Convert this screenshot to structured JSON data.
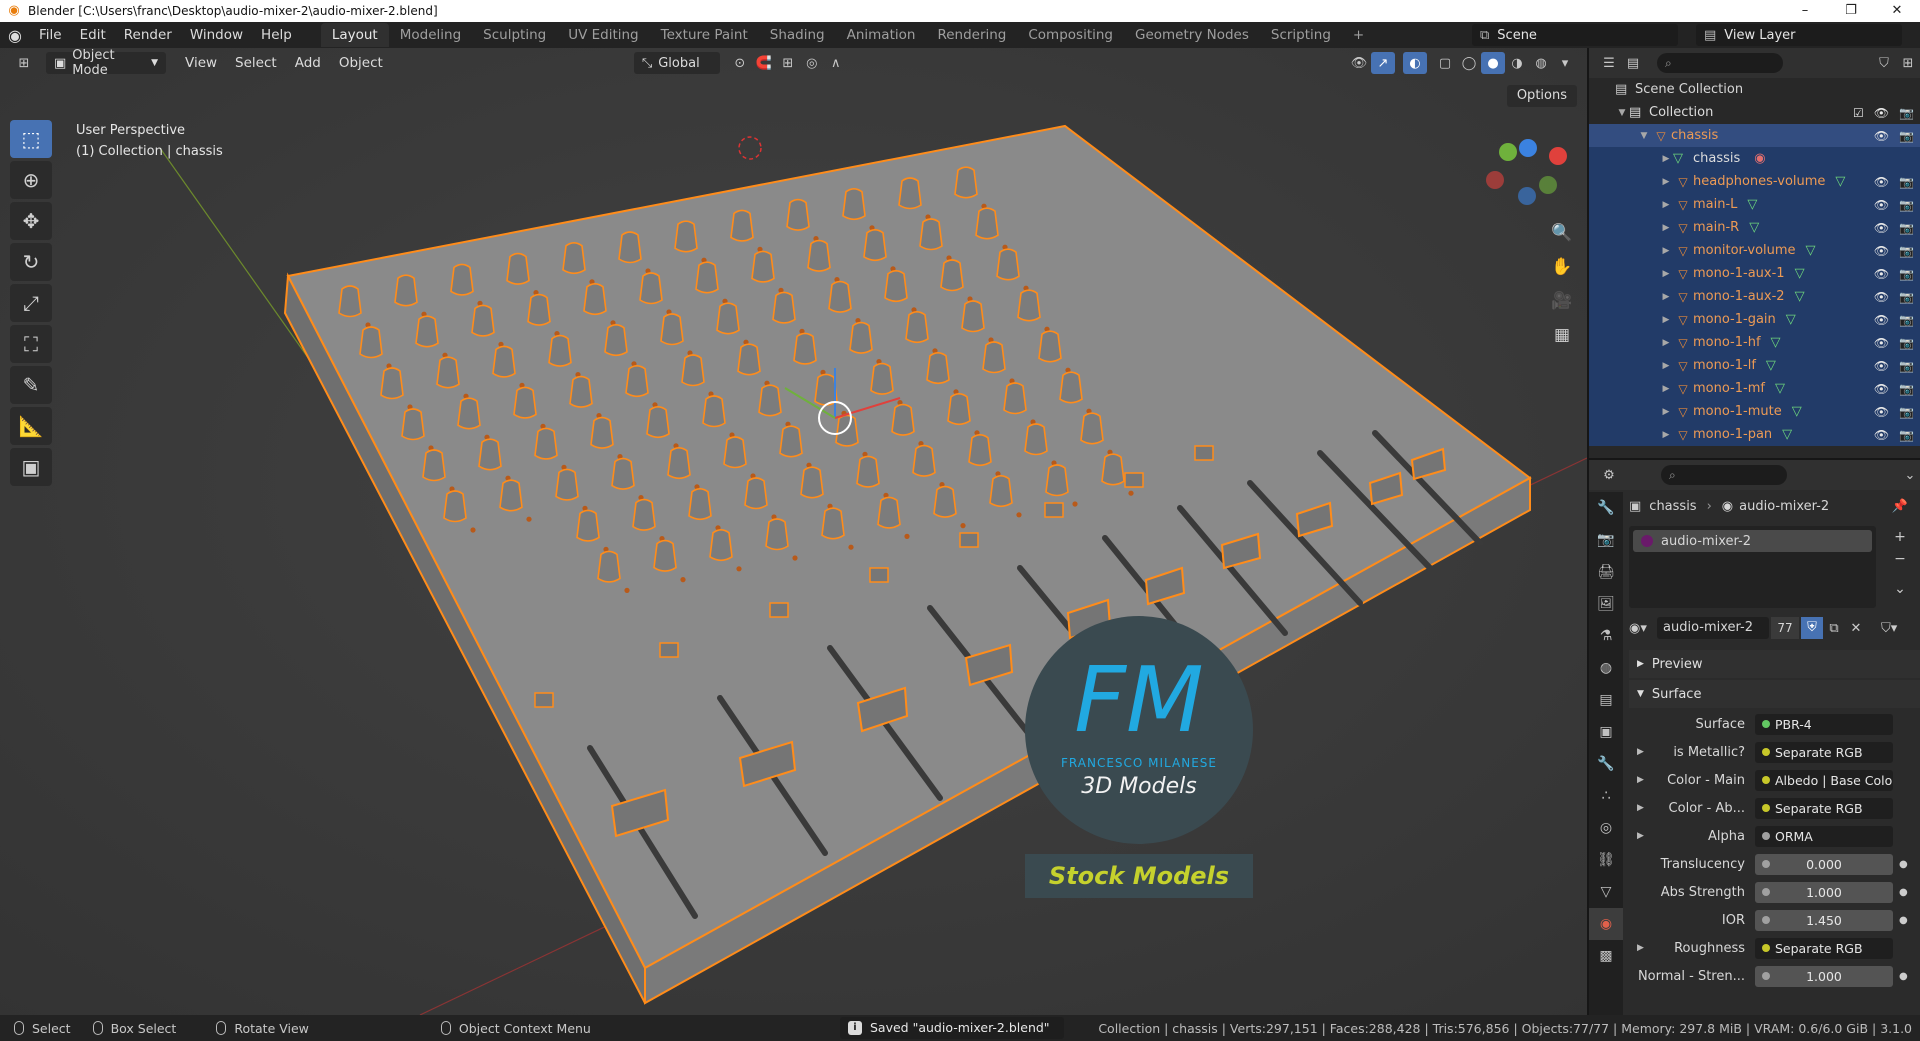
{
  "window": {
    "title": "Blender [C:\\Users\\franc\\Desktop\\audio-mixer-2\\audio-mixer-2.blend]",
    "controls": [
      "–",
      "❐",
      "✕"
    ]
  },
  "menus": [
    "File",
    "Edit",
    "Render",
    "Window",
    "Help"
  ],
  "workspaces": [
    {
      "label": "Layout",
      "active": true
    },
    {
      "label": "Modeling"
    },
    {
      "label": "Sculpting"
    },
    {
      "label": "UV Editing"
    },
    {
      "label": "Texture Paint"
    },
    {
      "label": "Shading"
    },
    {
      "label": "Animation"
    },
    {
      "label": "Rendering"
    },
    {
      "label": "Compositing"
    },
    {
      "label": "Geometry Nodes"
    },
    {
      "label": "Scripting"
    },
    {
      "label": "+"
    }
  ],
  "scene": {
    "name": "Scene",
    "view_layer": "View Layer"
  },
  "viewport": {
    "mode": "Object Mode",
    "menus": [
      "View",
      "Select",
      "Add",
      "Object"
    ],
    "transform_orientation": "Global",
    "options_label": "Options",
    "info_line1": "User Perspective",
    "info_line2": "(1) Collection | chassis"
  },
  "watermark": {
    "logo_letters": "FM",
    "brand": "FRANCESCO MILANESE",
    "subtitle": "3D Models",
    "banner": "Stock Models"
  },
  "outliner": {
    "scene_collection": "Scene Collection",
    "collection": "Collection",
    "selected_object": "chassis",
    "mesh_data": "chassis",
    "children": [
      "headphones-volume",
      "main-L",
      "main-R",
      "monitor-volume",
      "mono-1-aux-1",
      "mono-1-aux-2",
      "mono-1-gain",
      "mono-1-hf",
      "mono-1-lf",
      "mono-1-mf",
      "mono-1-mute",
      "mono-1-pan"
    ]
  },
  "properties": {
    "breadcrumb_object": "chassis",
    "breadcrumb_material": "audio-mixer-2",
    "material_slot": "audio-mixer-2",
    "material_name": "audio-mixer-2",
    "user_count": "77",
    "sections": {
      "preview": "Preview",
      "surface": "Surface"
    },
    "rows": [
      {
        "label": "Surface",
        "value": "PBR-4",
        "dot": "green",
        "expand": false
      },
      {
        "label": "is Metallic?",
        "value": "Separate RGB",
        "dot": "yellow",
        "expand": true
      },
      {
        "label": "Color - Main",
        "value": "Albedo | Base Color",
        "dot": "yellow",
        "expand": true
      },
      {
        "label": "Color - Ab...",
        "value": "Separate RGB",
        "dot": "yellow",
        "expand": true
      },
      {
        "label": "Alpha",
        "value": "ORMA",
        "dot": "grey",
        "expand": true
      },
      {
        "label": "Translucency",
        "value": "0.000",
        "dot": "grey",
        "numeric": true
      },
      {
        "label": "Abs Strength",
        "value": "1.000",
        "dot": "grey",
        "numeric": true
      },
      {
        "label": "IOR",
        "value": "1.450",
        "dot": "grey",
        "numeric": true
      },
      {
        "label": "Roughness",
        "value": "Separate RGB",
        "dot": "yellow",
        "expand": true
      },
      {
        "label": "Normal - Stren...",
        "value": "1.000",
        "dot": "grey",
        "numeric": true
      }
    ]
  },
  "status": {
    "select": "Select",
    "box_select": "Box Select",
    "rotate_view": "Rotate View",
    "context_menu": "Object Context Menu",
    "saved_message": "Saved \"audio-mixer-2.blend\"",
    "stats": "Collection | chassis | Verts:297,151 | Faces:288,428 | Tris:576,856 | Objects:77/77 | Memory: 297.8 MiB | VRAM: 0.6/6.0 GiB | 3.1.0"
  },
  "colors": {
    "accent_blue": "#4772b3",
    "selection_orange": "#ff8c1a",
    "viewport_bg": "#3d3d3d",
    "model_grey": "#8e8e8e"
  }
}
